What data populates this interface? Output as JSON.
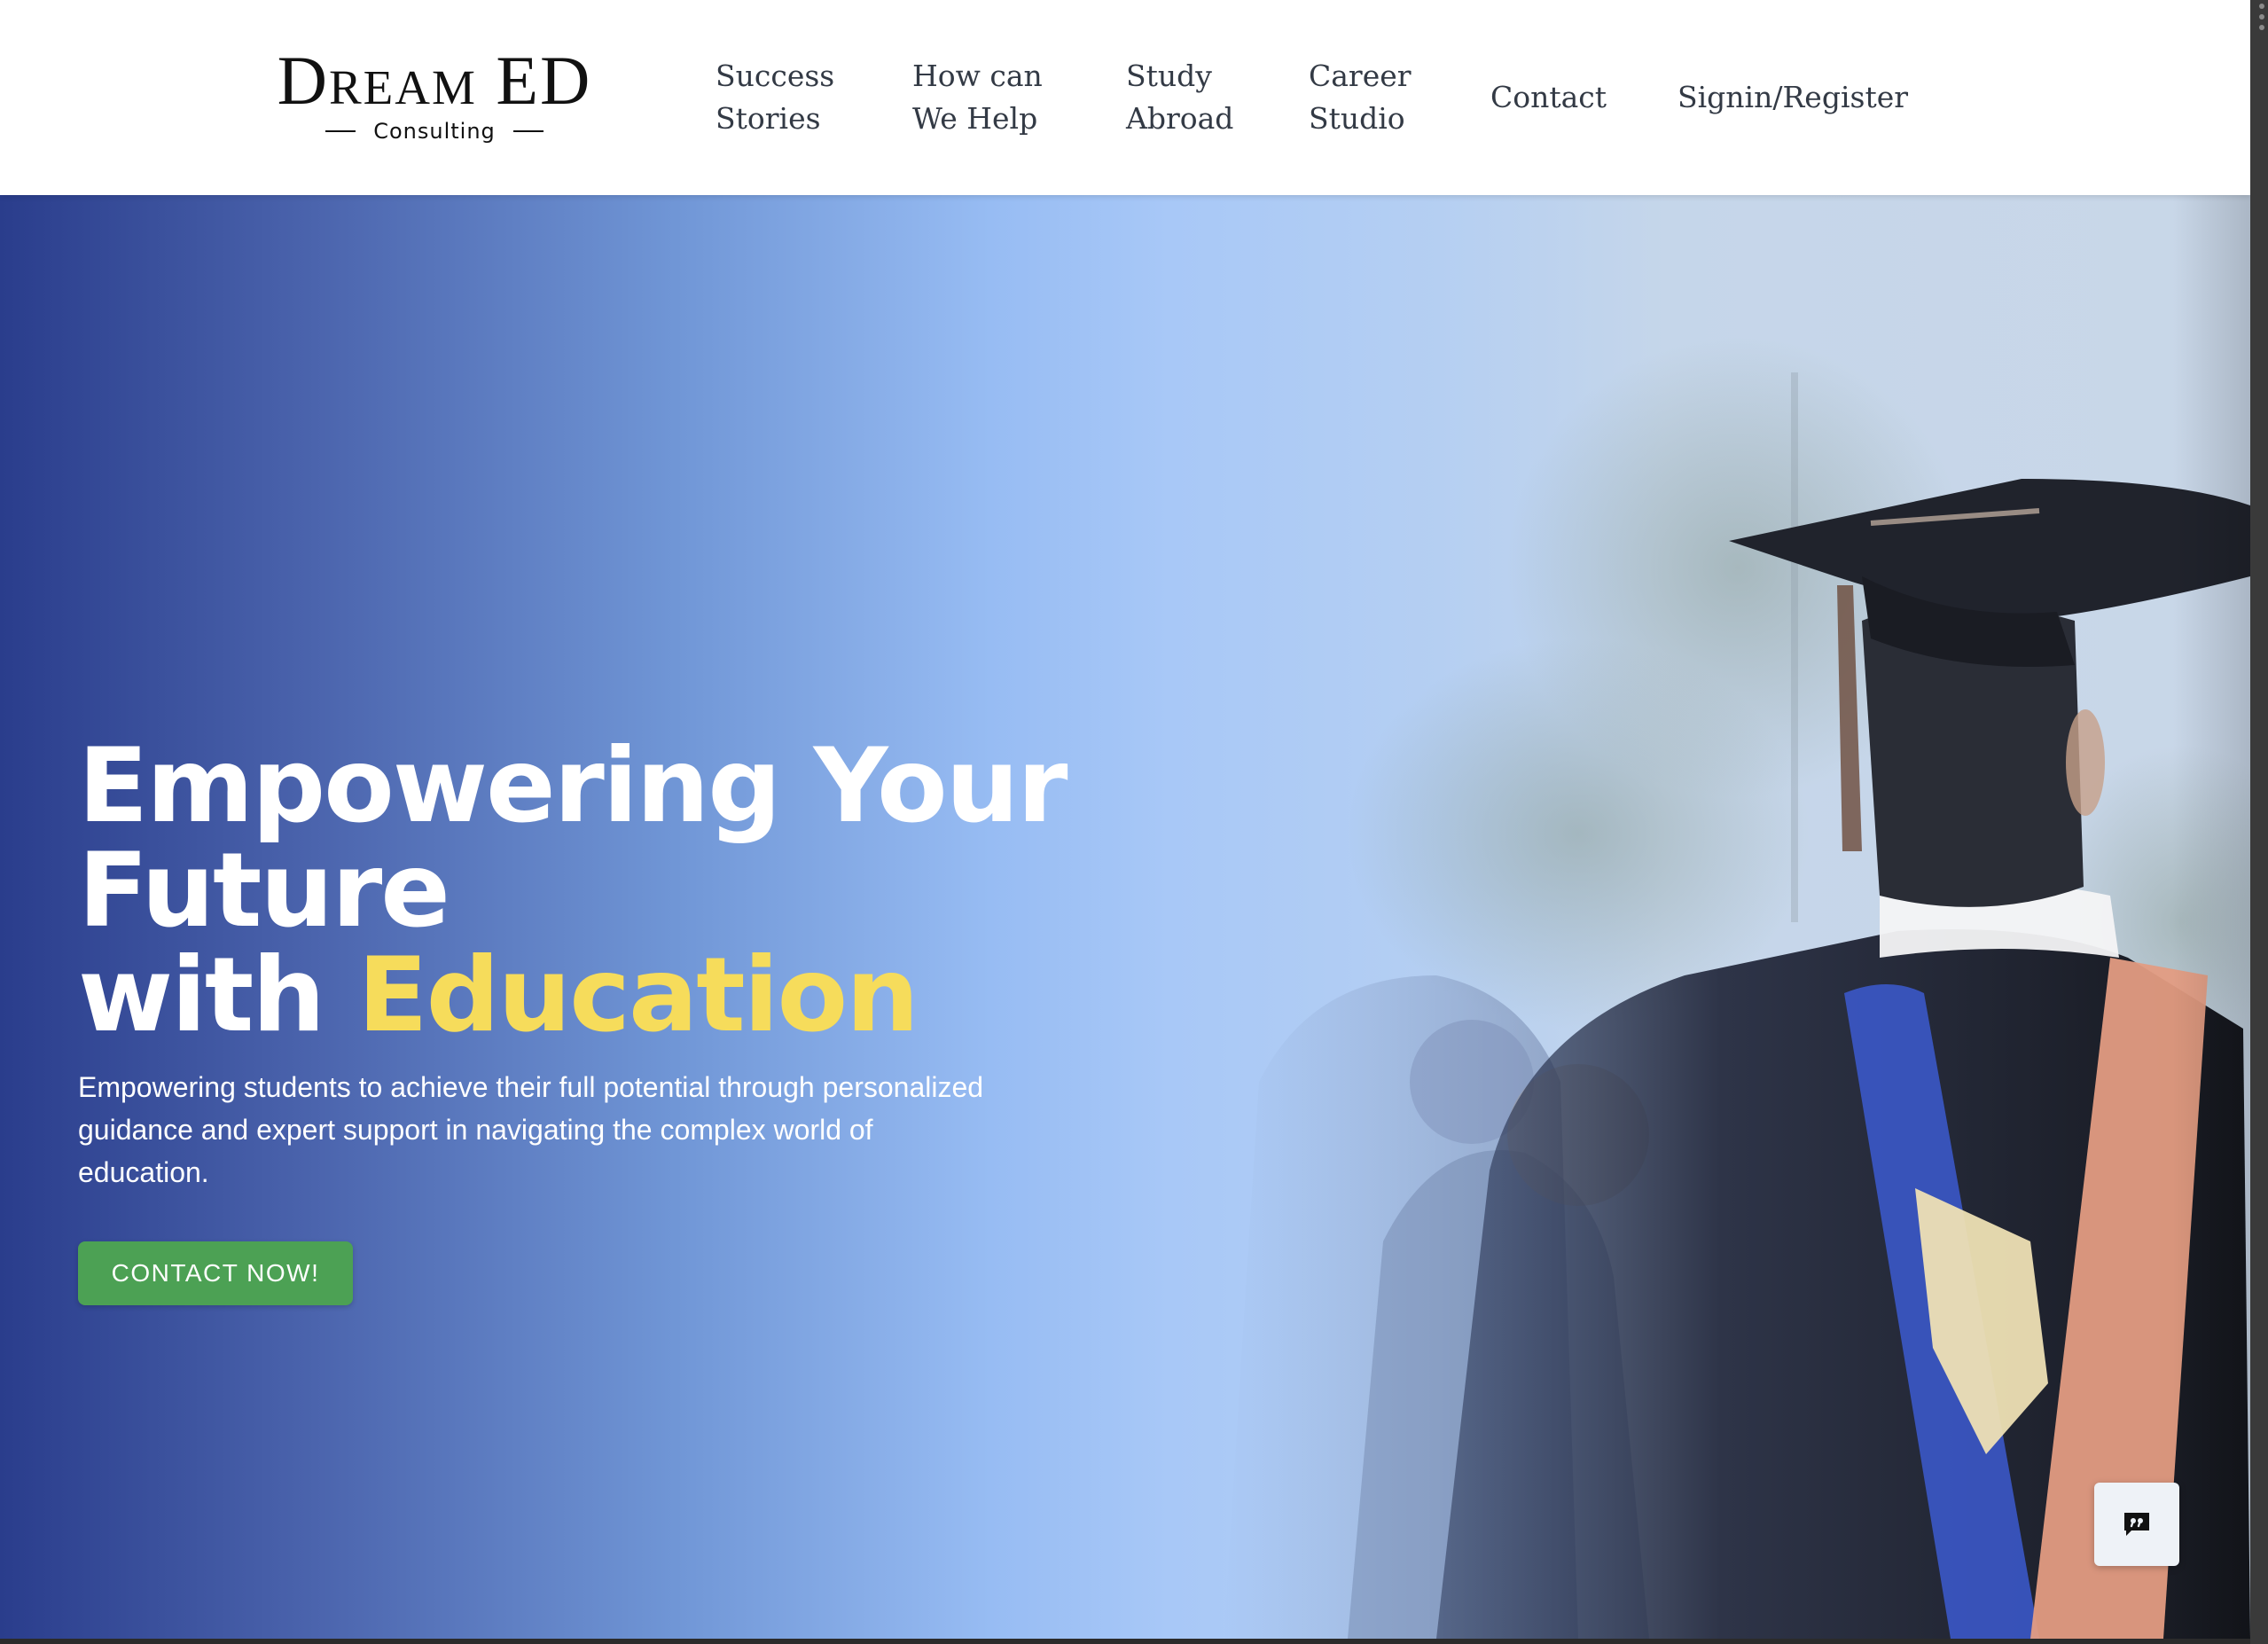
{
  "header": {
    "logo": {
      "main": "Dream ED",
      "sub": "Consulting"
    },
    "nav": [
      {
        "line1": "Success",
        "line2": "Stories"
      },
      {
        "line1": "How can",
        "line2": "We Help"
      },
      {
        "line1": "Study",
        "line2": "Abroad"
      },
      {
        "line1": "Career",
        "line2": "Studio"
      },
      {
        "line1": "Contact",
        "line2": ""
      },
      {
        "line1": "Signin/Register",
        "line2": ""
      }
    ]
  },
  "hero": {
    "title_line1": "Empowering Your",
    "title_line2": "Future",
    "title_line3_prefix": "with ",
    "title_line3_accent": "Education",
    "description": "Empowering students to achieve their full potential through personalized guidance and expert support in navigating the complex world of education.",
    "cta_label": "CONTACT NOW!",
    "background_image": "graduate-in-cap-and-gown-photo",
    "accent_color": "#f6dc5b",
    "cta_color": "#4ca154"
  },
  "chat_widget": {
    "icon": "chat-quote-icon"
  }
}
